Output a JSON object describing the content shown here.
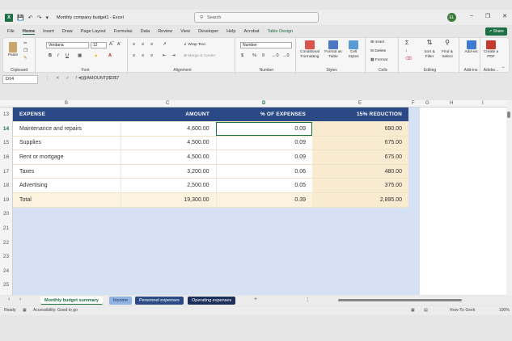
{
  "titlebar": {
    "title": "Monthly company budget1 - Excel",
    "search_placeholder": "Search",
    "user_initials": "EL"
  },
  "menu": {
    "tabs": [
      "File",
      "Home",
      "Insert",
      "Draw",
      "Page Layout",
      "Formulas",
      "Data",
      "Review",
      "View",
      "Developer",
      "Help",
      "Acrobat",
      "Table Design"
    ],
    "share_label": "Share"
  },
  "ribbon": {
    "clipboard": {
      "paste": "Paste",
      "group": "Clipboard"
    },
    "font": {
      "name": "Verdana",
      "size": "12",
      "group": "Font"
    },
    "alignment": {
      "wrap": "Wrap Text",
      "merge": "Merge & Center",
      "group": "Alignment"
    },
    "number": {
      "format": "Number",
      "group": "Number"
    },
    "styles": {
      "conditional": "Conditional Formatting",
      "format_table": "Format as Table",
      "cell_styles": "Cell Styles",
      "group": "Styles"
    },
    "cells": {
      "insert": "Insert",
      "delete": "Delete",
      "format": "Format",
      "group": "Cells"
    },
    "editing": {
      "sort": "Sort & Filter",
      "find": "Find & Select",
      "group": "Editing"
    },
    "addins": {
      "label": "Add-ins",
      "group": "Add-ins"
    },
    "adobe": {
      "label": "Create a PDF",
      "group": "Adobe..."
    }
  },
  "formula_bar": {
    "cell_ref": "D14",
    "formula": "=[@AMOUNT]/$D$7"
  },
  "columns": [
    "B",
    "C",
    "D",
    "E",
    "F",
    "G",
    "H",
    "I"
  ],
  "rows": [
    "13",
    "14",
    "15",
    "16",
    "17",
    "18",
    "19",
    "20",
    "21",
    "22",
    "23",
    "24",
    "25"
  ],
  "table": {
    "headers": [
      "EXPENSE",
      "AMOUNT",
      "% OF EXPENSES",
      "15% REDUCTION"
    ],
    "rows": [
      [
        "Maintenance and repairs",
        "4,600.00",
        "0.09",
        "690.00"
      ],
      [
        "Supplies",
        "4,500.00",
        "0.09",
        "675.00"
      ],
      [
        "Rent or mortgage",
        "4,500.00",
        "0.09",
        "675.00"
      ],
      [
        "Taxes",
        "3,200.00",
        "0.06",
        "480.00"
      ],
      [
        "Advertising",
        "2,500.00",
        "0.05",
        "375.00"
      ],
      [
        "Total",
        "19,300.00",
        "0.39",
        "2,895.00"
      ]
    ]
  },
  "sheet_tabs": [
    "Monthly budget summary",
    "Income",
    "Personnel expenses",
    "Operating expenses"
  ],
  "status": {
    "ready": "Ready",
    "accessibility": "Accessibility: Good to go",
    "zoom": "100%",
    "watermark": "How-To Geek"
  }
}
